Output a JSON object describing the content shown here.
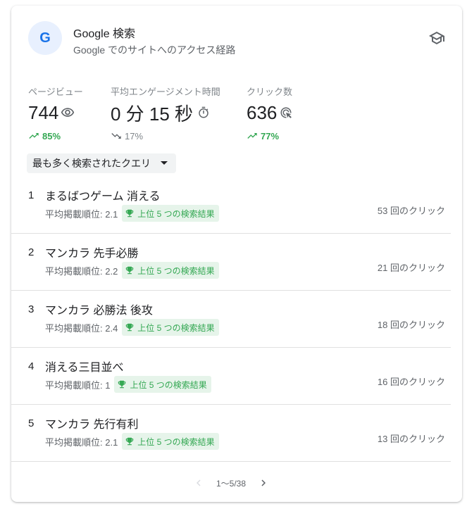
{
  "header": {
    "logo_letter": "G",
    "title": "Google 検索",
    "subtitle": "Google でのサイトへのアクセス経路",
    "icon": "school-icon"
  },
  "metrics": [
    {
      "label": "ページビュー",
      "value": "744",
      "icon": "eye-icon",
      "delta": "85%",
      "trend": "up"
    },
    {
      "label": "平均エンゲージメント時間",
      "value": "0 分 15 秒",
      "icon": "timer-icon",
      "delta": "17%",
      "trend": "down"
    },
    {
      "label": "クリック数",
      "value": "636",
      "icon": "click-icon",
      "delta": "77%",
      "trend": "up"
    }
  ],
  "dropdown": {
    "label": "最も多く検索されたクエリ"
  },
  "queries": [
    {
      "rank": "1",
      "query": "まるばつゲーム 消える",
      "position": "平均掲載順位: 2.1",
      "badge": "上位 5 つの検索結果",
      "clicks": "53 回のクリック"
    },
    {
      "rank": "2",
      "query": "マンカラ 先手必勝",
      "position": "平均掲載順位: 2.2",
      "badge": "上位 5 つの検索結果",
      "clicks": "21 回のクリック"
    },
    {
      "rank": "3",
      "query": "マンカラ 必勝法 後攻",
      "position": "平均掲載順位: 2.4",
      "badge": "上位 5 つの検索結果",
      "clicks": "18 回のクリック"
    },
    {
      "rank": "4",
      "query": "消える三目並べ",
      "position": "平均掲載順位: 1",
      "badge": "上位 5 つの検索結果",
      "clicks": "16 回のクリック"
    },
    {
      "rank": "5",
      "query": "マンカラ 先行有利",
      "position": "平均掲載順位: 2.1",
      "badge": "上位 5 つの検索結果",
      "clicks": "13 回のクリック"
    }
  ],
  "pagination": {
    "label": "1〜5/38"
  },
  "colors": {
    "accent": "#1a73e8",
    "positive": "#34a853",
    "badge_bg": "#e6f4ea",
    "muted": "#5f6368"
  }
}
